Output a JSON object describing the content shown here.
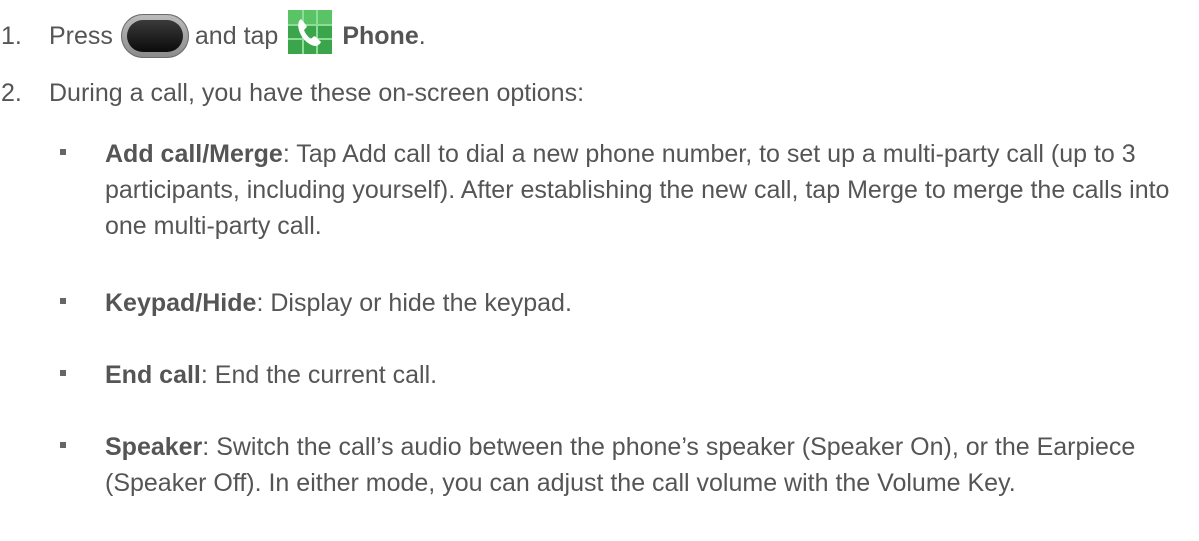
{
  "steps": [
    {
      "number": "1.",
      "text_before": "Press",
      "icon_home": "home-key-icon",
      "text_middle": "and tap",
      "icon_phone": "phone-app-icon",
      "label_bold": "Phone",
      "text_after": "."
    },
    {
      "number": "2.",
      "text": "During a call, you have these on-screen options:"
    }
  ],
  "options": [
    {
      "title": "Add call/Merge",
      "description": ": Tap Add call to dial a new phone number, to set up a multi-party call (up to 3 participants, including yourself). After establishing the new call, tap Merge to merge the calls into one multi-party call."
    },
    {
      "title": "Keypad/Hide",
      "description": ": Display or hide the keypad."
    },
    {
      "title": "End call",
      "description": ": End the current call."
    },
    {
      "title": "Speaker",
      "description": ": Switch the call’s audio between the phone’s speaker (Speaker On), or the Earpiece (Speaker Off). In either mode, you can adjust the call volume with the Volume Key."
    }
  ],
  "colors": {
    "text": "#555555",
    "phone_icon_green": "#3aa54a"
  }
}
